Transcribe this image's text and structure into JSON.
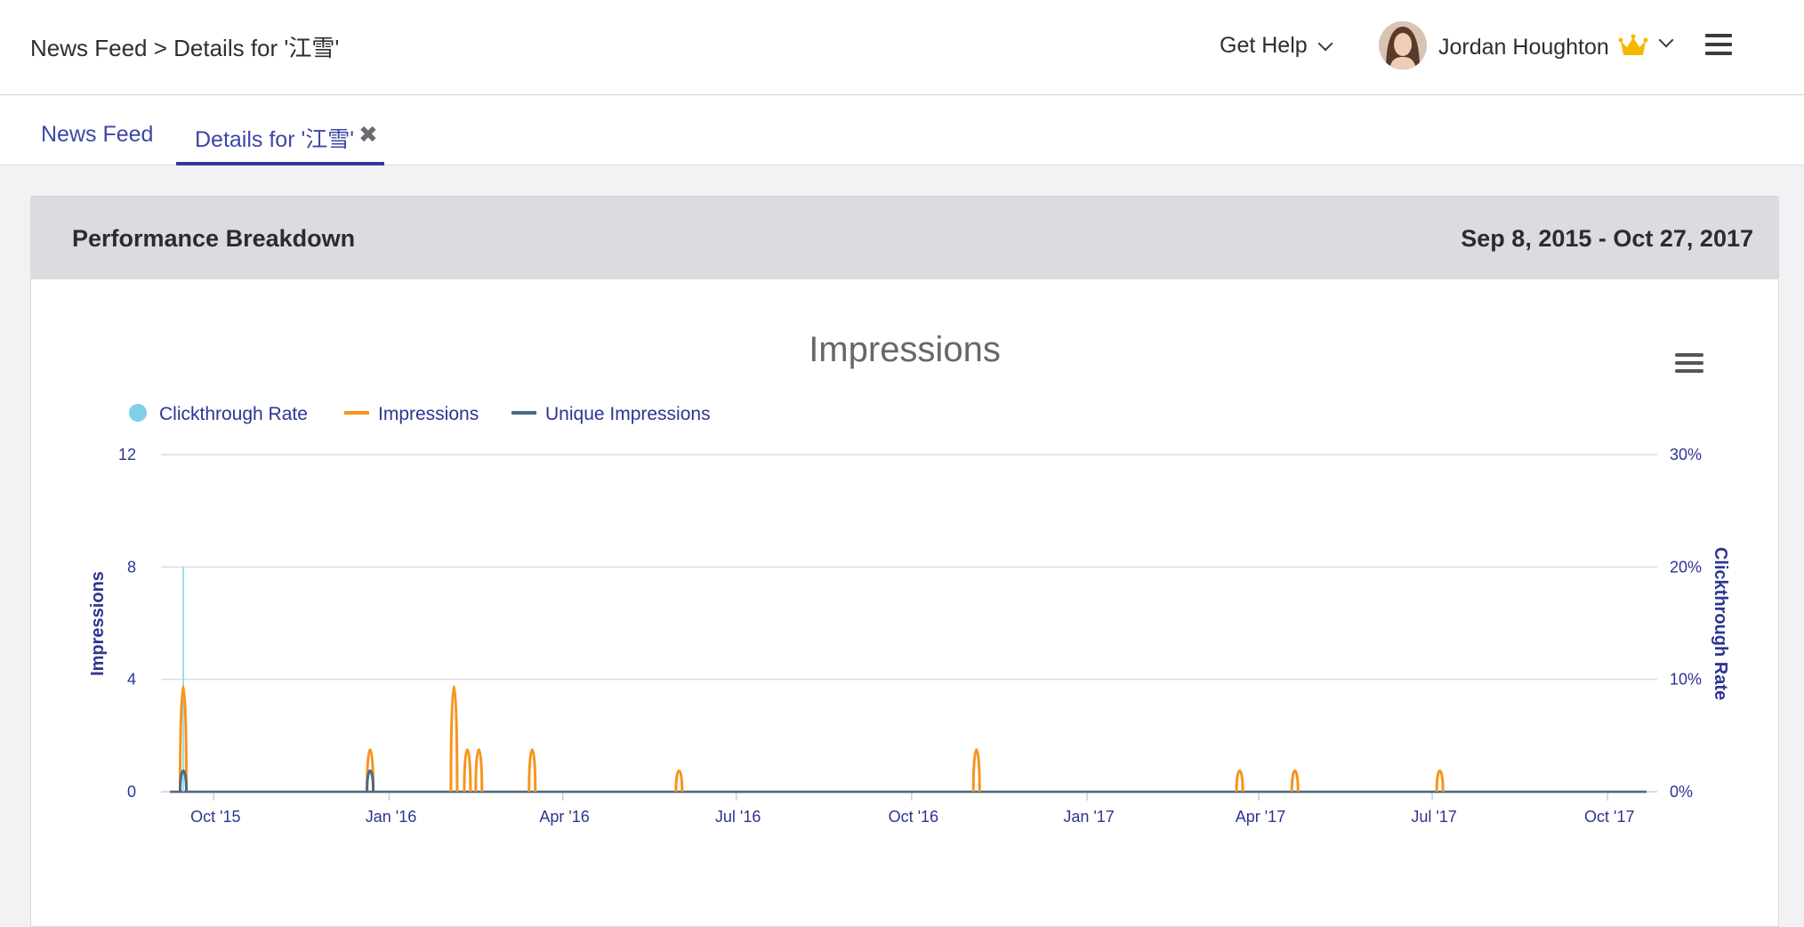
{
  "header": {
    "breadcrumb": "News Feed > Details for '江雪'",
    "help_label": "Get Help",
    "user_name": "Jordan Houghton"
  },
  "tabs": [
    {
      "label": "News Feed"
    },
    {
      "label": "Details for '江雪'"
    }
  ],
  "card": {
    "title": "Performance Breakdown",
    "date_range": "Sep 8, 2015 - Oct 27, 2017"
  },
  "colors": {
    "impressions": "#f7941d",
    "unique_impressions": "#4d6a86",
    "clickthrough_rate": "#7ed0e6",
    "tab_active": "#2f3a9c",
    "axis_text": "#2e3591"
  },
  "chart_data": {
    "type": "line",
    "title": "Impressions",
    "ylabel": "Impressions",
    "y2label": "Clickthrough Rate",
    "ylim": [
      0,
      12
    ],
    "y2lim": [
      0,
      30
    ],
    "yticks": [
      "0",
      "4",
      "8",
      "12"
    ],
    "y2ticks": [
      "0%",
      "10%",
      "20%",
      "30%"
    ],
    "xlim": [
      "2015-09-08",
      "2017-10-27"
    ],
    "xticks": [
      {
        "date": "2015-10-01",
        "label": "Oct '15"
      },
      {
        "date": "2016-01-01",
        "label": "Jan '16"
      },
      {
        "date": "2016-04-01",
        "label": "Apr '16"
      },
      {
        "date": "2016-07-01",
        "label": "Jul '16"
      },
      {
        "date": "2016-10-01",
        "label": "Oct '16"
      },
      {
        "date": "2017-01-01",
        "label": "Jan '17"
      },
      {
        "date": "2017-04-01",
        "label": "Apr '17"
      },
      {
        "date": "2017-07-01",
        "label": "Jul '17"
      },
      {
        "date": "2017-10-01",
        "label": "Oct '17"
      }
    ],
    "legend": [
      "Clickthrough Rate",
      "Impressions",
      "Unique Impressions"
    ],
    "legend_position": "top-left",
    "grid": true,
    "series": [
      {
        "name": "Impressions",
        "axis": "left",
        "points": [
          {
            "date": "2015-09-15",
            "value": 5
          },
          {
            "date": "2015-12-22",
            "value": 2
          },
          {
            "date": "2016-02-04",
            "value": 5
          },
          {
            "date": "2016-02-11",
            "value": 2
          },
          {
            "date": "2016-02-17",
            "value": 2
          },
          {
            "date": "2016-03-16",
            "value": 2
          },
          {
            "date": "2016-06-01",
            "value": 1
          },
          {
            "date": "2016-11-04",
            "value": 2
          },
          {
            "date": "2017-03-22",
            "value": 1
          },
          {
            "date": "2017-04-20",
            "value": 1
          },
          {
            "date": "2017-07-05",
            "value": 1
          }
        ]
      },
      {
        "name": "Unique Impressions",
        "axis": "left",
        "points": [
          {
            "date": "2015-09-15",
            "value": 1
          },
          {
            "date": "2015-12-22",
            "value": 1
          }
        ]
      },
      {
        "name": "Clickthrough Rate",
        "axis": "right",
        "points": [
          {
            "date": "2015-09-15",
            "value": 20
          }
        ]
      }
    ]
  }
}
